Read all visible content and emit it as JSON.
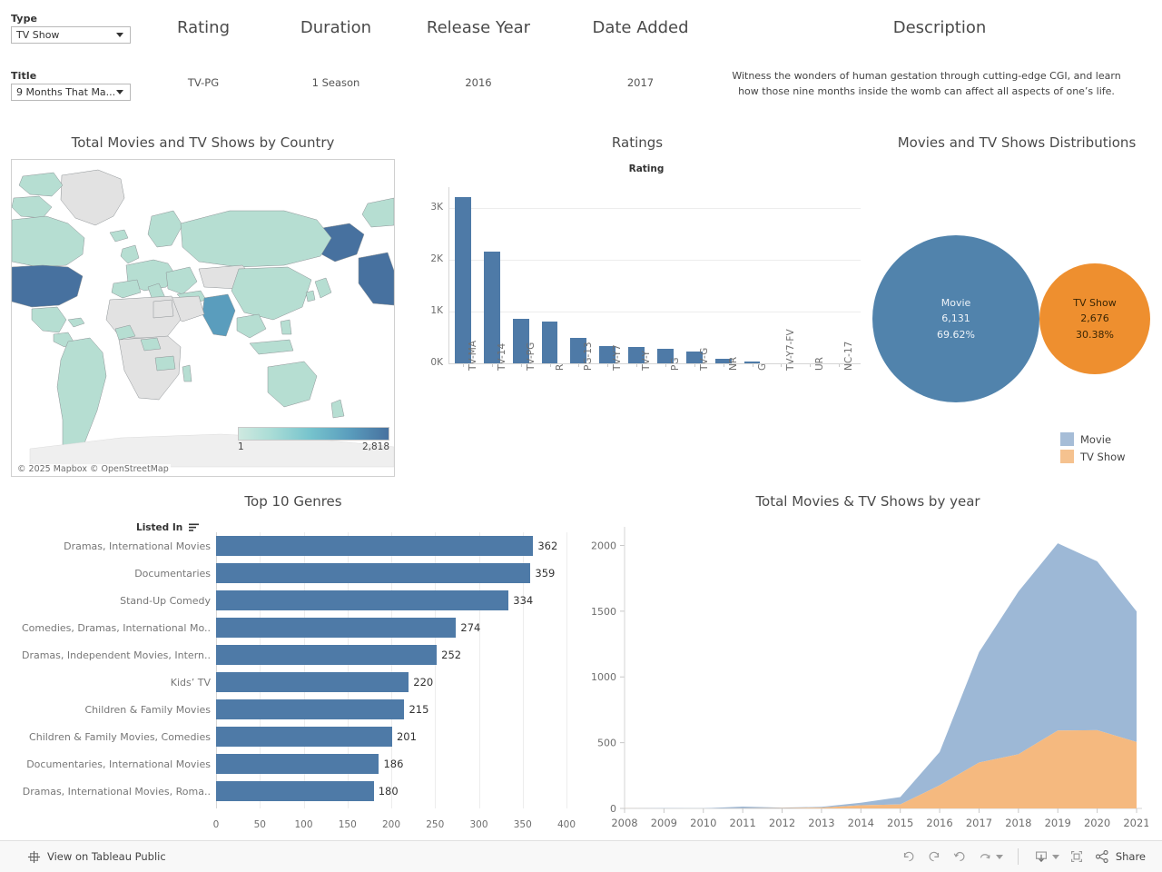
{
  "filters": {
    "type": {
      "label": "Type",
      "value": "TV Show",
      "icon": "chevron-down-icon"
    },
    "title": {
      "label": "Title",
      "value": "9 Months That Ma...",
      "icon": "chevron-down-icon"
    }
  },
  "detail_header": {
    "columns": [
      {
        "label": "Rating",
        "value": "TV-PG"
      },
      {
        "label": "Duration",
        "value": "1 Season"
      },
      {
        "label": "Release Year",
        "value": "2016"
      },
      {
        "label": "Date Added",
        "value": "2017"
      },
      {
        "label": "Description",
        "value": "Witness the wonders of human gestation through cutting-edge CGI, and learn how those nine months inside the womb can affect all aspects of one’s life."
      }
    ]
  },
  "map_panel": {
    "title": "Total Movies and TV Shows by Country",
    "legend_min": "1",
    "legend_max": "2,818",
    "credit": "© 2025 Mapbox © OpenStreetMap"
  },
  "ratings_panel": {
    "title": "Ratings",
    "axis_header": "Rating"
  },
  "bubbles_panel": {
    "title": "Movies and TV Shows Distributions",
    "legend": [
      {
        "label": "Movie",
        "color": "#a6bdd7"
      },
      {
        "label": "TV Show",
        "color": "#f5c28f"
      }
    ],
    "bubbles": [
      {
        "name": "Movie",
        "count": "6,131",
        "percent": "69.62%",
        "color": "#5183ac"
      },
      {
        "name": "TV Show",
        "count": "2,676",
        "percent": "30.38%",
        "color": "#ee8f2f"
      }
    ]
  },
  "genres_panel": {
    "title": "Top 10 Genres",
    "axis_header": "Listed In"
  },
  "year_panel": {
    "title": "Total Movies & TV Shows by year"
  },
  "toolbar": {
    "view_label": "View on Tableau Public",
    "share_label": "Share",
    "buttons": [
      "undo-icon",
      "redo-icon",
      "revert-icon",
      "refresh-icon",
      "download-icon",
      "fullscreen-icon",
      "share-icon"
    ]
  },
  "chart_data": [
    {
      "type": "bar",
      "title": "Ratings",
      "xlabel": "Rating",
      "ylabel": "",
      "ylim": [
        0,
        3400
      ],
      "yticks": [
        "0K",
        "1K",
        "2K",
        "3K"
      ],
      "ytickvals": [
        0,
        1000,
        2000,
        3000
      ],
      "grid": true,
      "categories": [
        "TV-MA",
        "TV-14",
        "TV-PG",
        "R",
        "PG-13",
        "TV-Y7",
        "TV-Y",
        "PG",
        "TV-G",
        "NR",
        "G",
        "TV-Y7-FV",
        "UR",
        "NC-17"
      ],
      "values": [
        3207,
        2160,
        863,
        799,
        490,
        334,
        307,
        287,
        220,
        80,
        41,
        6,
        3,
        3
      ],
      "color": "#4e7aa7"
    },
    {
      "type": "pie",
      "title": "Movies and TV Shows Distributions",
      "labels": [
        "Movie",
        "TV Show"
      ],
      "values": [
        6131,
        2676
      ],
      "percents": [
        69.62,
        30.38
      ],
      "colors": [
        "#5183ac",
        "#ee8f2f"
      ],
      "legend_position": "bottom-right"
    },
    {
      "type": "bar",
      "title": "Top 10 Genres",
      "orientation": "horizontal",
      "xlabel": "",
      "ylabel": "Listed In",
      "xlim": [
        0,
        400
      ],
      "xticks": [
        "0",
        "50",
        "100",
        "150",
        "200",
        "250",
        "300",
        "350",
        "400"
      ],
      "xtickvals": [
        0,
        50,
        100,
        150,
        200,
        250,
        300,
        350,
        400
      ],
      "grid": true,
      "categories": [
        "Dramas, International Movies",
        "Documentaries",
        "Stand-Up Comedy",
        "Comedies, Dramas, International Mo..",
        "Dramas, Independent Movies, Intern..",
        "Kids’ TV",
        "Children & Family Movies",
        "Children & Family Movies, Comedies",
        "Documentaries, International Movies",
        "Dramas, International Movies, Roma.."
      ],
      "values": [
        362,
        359,
        334,
        274,
        252,
        220,
        215,
        201,
        186,
        180
      ],
      "color": "#4e7aa7"
    },
    {
      "type": "area",
      "title": "Total Movies & TV Shows by year",
      "stacked": true,
      "xlabel": "",
      "ylabel": "",
      "ylim": [
        0,
        2100
      ],
      "yticks": [
        "0",
        "500",
        "1000",
        "1500",
        "2000"
      ],
      "ytickvals": [
        0,
        500,
        1000,
        1500,
        2000
      ],
      "x": [
        2008,
        2009,
        2010,
        2011,
        2012,
        2013,
        2014,
        2015,
        2016,
        2017,
        2018,
        2019,
        2020,
        2021
      ],
      "series": [
        {
          "name": "TV Show",
          "color": "#f5b97f",
          "values": [
            1,
            0,
            0,
            1,
            3,
            6,
            24,
            30,
            176,
            349,
            412,
            592,
            595,
            505
          ]
        },
        {
          "name": "Movie",
          "color": "#9db8d6",
          "values": [
            1,
            2,
            1,
            13,
            3,
            6,
            19,
            56,
            253,
            839,
            1237,
            1424,
            1284,
            993
          ]
        }
      ],
      "legend_position": "none"
    }
  ]
}
